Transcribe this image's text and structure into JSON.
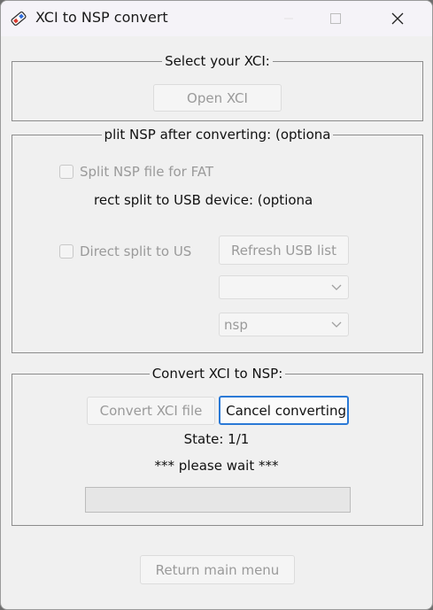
{
  "window": {
    "title": "XCI to NSP convert"
  },
  "select_group": {
    "legend": "Select your XCI:",
    "open_button": "Open XCI"
  },
  "split_group": {
    "legend": "plit NSP after converting: (optiona",
    "split_checkbox_label": "Split NSP file for FAT",
    "split_checked": false,
    "direct_split_heading": "rect split to USB device: (optiona",
    "usb_checkbox_label": "Direct split to US",
    "usb_checked": false,
    "refresh_button": "Refresh USB list",
    "usb_device_value": "",
    "format_value": "nsp"
  },
  "convert_group": {
    "legend": "Convert XCI to NSP:",
    "convert_button": "Convert XCI file",
    "cancel_button": "Cancel converting",
    "state_text": "State: 1/1",
    "wait_text": "*** please wait ***",
    "progress_fraction": 0
  },
  "footer": {
    "return_button": "Return main menu"
  },
  "colors": {
    "accent_focus": "#2a79d6",
    "window_bg": "#f0f0f0"
  }
}
